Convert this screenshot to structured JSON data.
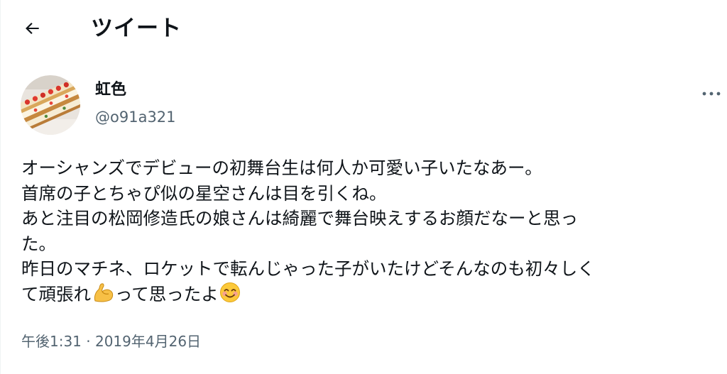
{
  "header": {
    "back_icon": "arrow-left-icon",
    "title": "ツイート"
  },
  "author": {
    "display_name": "虹色",
    "handle": "@o91a321",
    "avatar": "cake-photo-avatar"
  },
  "more_icon": "more-horizontal-icon",
  "tweet": {
    "lines": {
      "l1": "オーシャンズでデビューの初舞台生は何人か可愛い子いたなあー。",
      "l2": "首席の子とちゃぴ似の星空さんは目を引くね。",
      "l3": "あと注目の松岡修造氏の娘さんは綺麗で舞台映えするお顔だなーと思っ",
      "l4": "た。",
      "l5": "昨日のマチネ、ロケットで転んじゃった子がいたけどそんなのも初々しく",
      "l6a": "て頑張れ",
      "l6b": "って思ったよ"
    },
    "emoji": [
      "flexed-biceps-emoji",
      "smiling-face-with-smiling-eyes-emoji"
    ]
  },
  "timestamp": "午後1:31 · 2019年4月26日",
  "colors": {
    "text": "#0f1419",
    "secondary": "#536471",
    "border": "#eff3f4"
  }
}
